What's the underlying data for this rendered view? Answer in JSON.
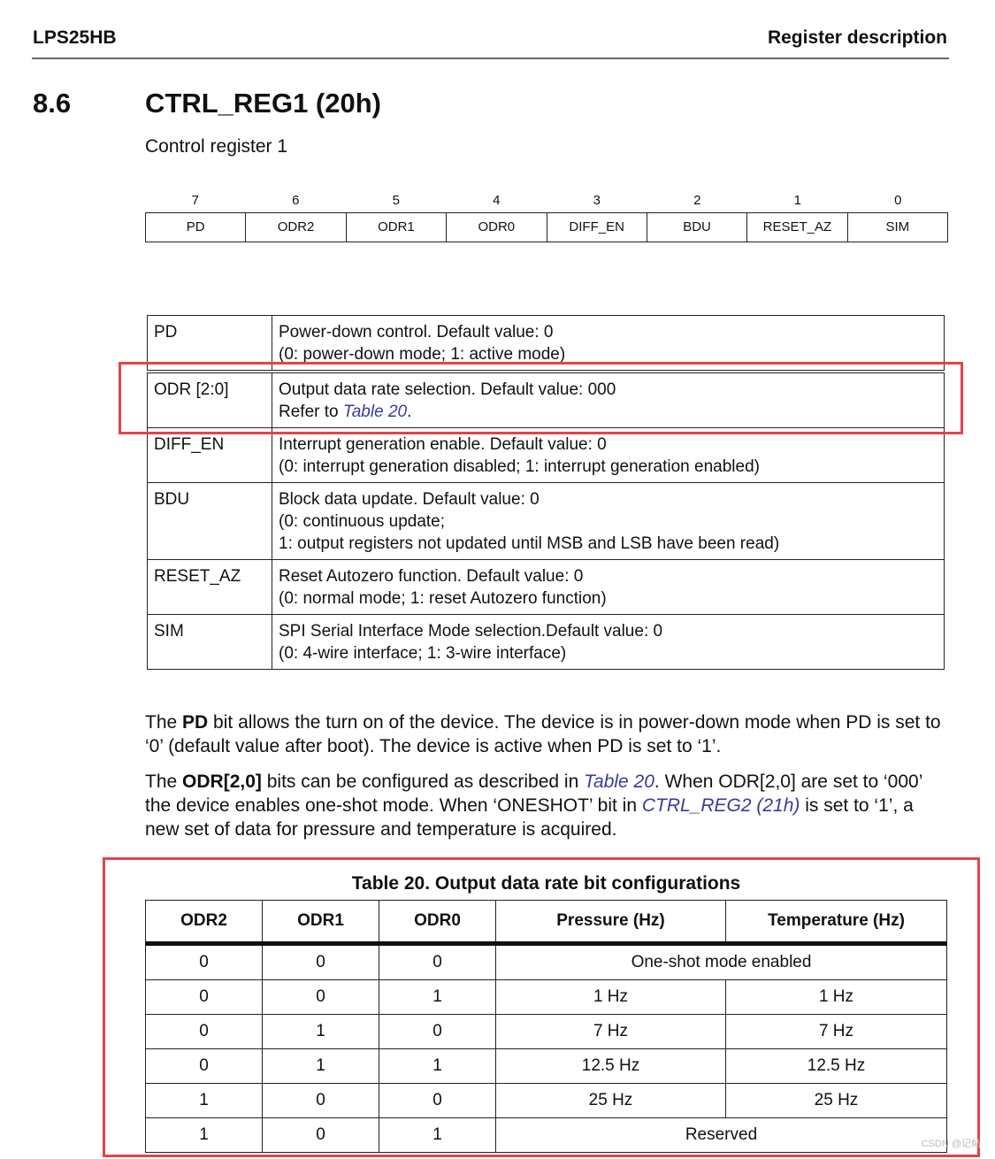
{
  "header": {
    "doc_name": "LPS25HB",
    "section_name": "Register description"
  },
  "section": {
    "number": "8.6",
    "title": "CTRL_REG1 (20h)",
    "subtitle": "Control register 1"
  },
  "bitmap": {
    "bits": [
      {
        "num": "7",
        "name": "PD"
      },
      {
        "num": "6",
        "name": "ODR2"
      },
      {
        "num": "5",
        "name": "ODR1"
      },
      {
        "num": "4",
        "name": "ODR0"
      },
      {
        "num": "3",
        "name": "DIFF_EN"
      },
      {
        "num": "2",
        "name": "BDU"
      },
      {
        "num": "1",
        "name": "RESET_AZ"
      },
      {
        "num": "0",
        "name": "SIM"
      }
    ]
  },
  "fields": {
    "pd": {
      "name": "PD",
      "line1": "Power-down control. Default value: 0",
      "line2": "(0: power-down mode; 1: active mode)"
    },
    "odr": {
      "name": "ODR [2:0]",
      "line1": "Output data rate selection. Default value: 000",
      "line2_prefix": "Refer to ",
      "line2_link": "Table 20",
      "line2_suffix": "."
    },
    "diff_en": {
      "name": "DIFF_EN",
      "line1": "Interrupt generation enable. Default value: 0",
      "line2": "(0: interrupt generation disabled; 1: interrupt generation enabled)"
    },
    "bdu": {
      "name": "BDU",
      "line1": "Block data update. Default value: 0",
      "line2": "(0: continuous update;",
      "line3": "1: output registers not updated until MSB and LSB have been read)"
    },
    "reset_az": {
      "name": "RESET_AZ",
      "line1": "Reset Autozero function. Default value: 0",
      "line2": "(0: normal mode; 1: reset Autozero function)"
    },
    "sim": {
      "name": "SIM",
      "line1": "SPI Serial Interface Mode selection.Default value: 0",
      "line2": "(0: 4-wire interface; 1: 3-wire interface)"
    }
  },
  "paragraphs": {
    "p1": {
      "t1": "The ",
      "b1": "PD",
      "t2": " bit allows the turn on of the device. The device is in power-down mode when PD is set to ‘0’ (default value after boot). The device is active when PD is set to ‘1’."
    },
    "p2": {
      "t1": "The ",
      "b1": "ODR[2,0]",
      "t2": " bits can be configured as described in ",
      "link1": "Table 20",
      "t3": ". When ODR[2,0] are set to ‘000’ the device enables one-shot mode. When ‘ONESHOT’ bit in ",
      "link2": "CTRL_REG2 (21h)",
      "t4": " is set to ‘1’, a new set of data for pressure and temperature is acquired."
    }
  },
  "table20": {
    "caption": "Table 20. Output data rate bit configurations",
    "headers": [
      "ODR2",
      "ODR1",
      "ODR0",
      "Pressure (Hz)",
      "Temperature (Hz)"
    ],
    "rows": [
      {
        "odr2": "0",
        "odr1": "0",
        "odr0": "0",
        "merged": "One-shot mode enabled"
      },
      {
        "odr2": "0",
        "odr1": "0",
        "odr0": "1",
        "pressure": "1 Hz",
        "temperature": "1 Hz"
      },
      {
        "odr2": "0",
        "odr1": "1",
        "odr0": "0",
        "pressure": "7 Hz",
        "temperature": "7 Hz"
      },
      {
        "odr2": "0",
        "odr1": "1",
        "odr0": "1",
        "pressure": "12.5 Hz",
        "temperature": "12.5 Hz"
      },
      {
        "odr2": "1",
        "odr1": "0",
        "odr0": "0",
        "pressure": "25 Hz",
        "temperature": "25 Hz"
      },
      {
        "odr2": "1",
        "odr1": "0",
        "odr0": "1",
        "merged": "Reserved"
      }
    ]
  },
  "annotation": {
    "highlight_color": "#e0454a"
  },
  "watermark": "CSDN @记帖"
}
